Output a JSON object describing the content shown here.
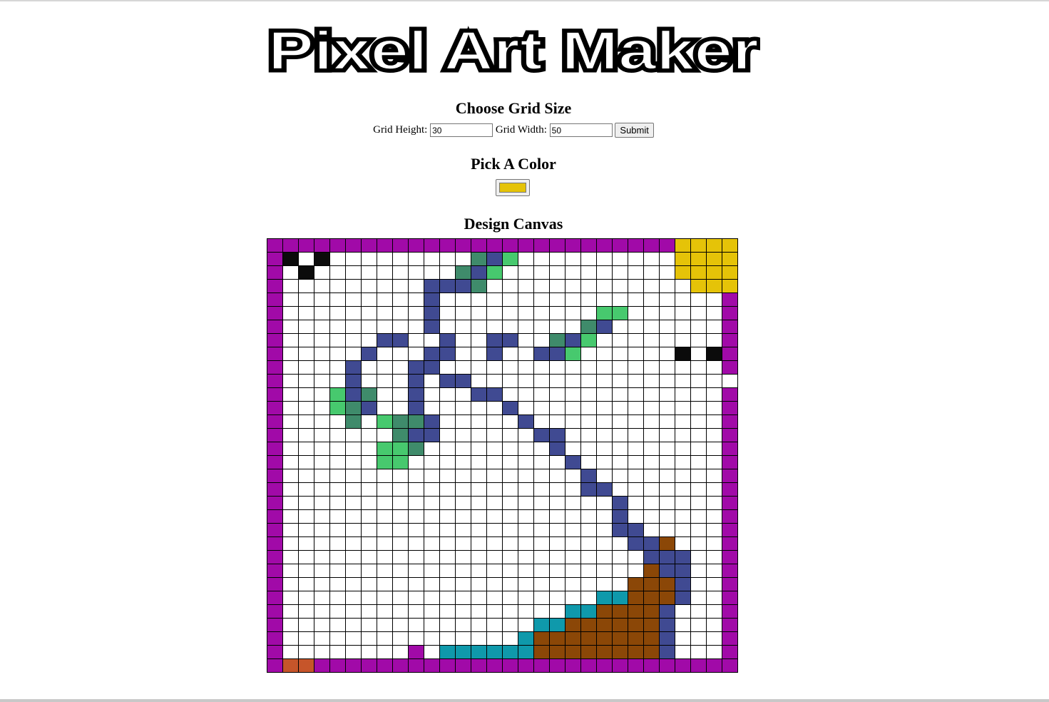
{
  "page": {
    "logo_text": "Pixel Art Maker",
    "grid_heading": "Choose Grid Size",
    "grid_height_label": "Grid Height:",
    "grid_height_value": "30",
    "grid_width_label": "Grid Width:",
    "grid_width_value": "50",
    "submit_label": "Submit",
    "color_heading": "Pick A Color",
    "selected_color": "#e5c308",
    "canvas_heading": "Design Canvas"
  },
  "canvas": {
    "visible_columns": 30,
    "visible_rows": 32,
    "palette": {
      "P": "#a10aa8",
      "Y": "#e5c308",
      "K": "#0b0b0b",
      "B": "#404a92",
      "G": "#3f8b6b",
      "L": "#47c96e",
      "T": "#0f99ab",
      "R": "#8b4707",
      "O": "#c6552a",
      ".": "#ffffff"
    },
    "rows": [
      "PPPPPPPPPPPPPPPPPPPPPPPPPPYYYY",
      "PK.K.........GBL..........YYYY",
      "P.K.........GBL...........YYYY",
      "P.........BBBG.............YYY",
      "P.........B..................P",
      "P.........B..........LL......P",
      "P.........B.........GB.......P",
      "P......BB..B..BB..GBL........P",
      "P.....B...BB..B..BBL......K.KP",
      "P....B...BB..................P",
      "P....B...B.BB..................P",
      "P...LBG..B...BB..............P",
      "P...LGB..B.....B.............P",
      "P....G.LGGB.....B............P",
      "P.......GBB......BB..........P",
      "P......LLG........B..........P",
      "P......LL..........B.........P",
      "P...................B........P",
      "P...................BB.......P",
      "P.....................B......P",
      "P.....................B......P",
      "P.....................BB.....P",
      "P......................BBR...P",
      "P.......................BBB..P",
      "P.......................RBB..P",
      "P......................RRRB..P",
      "P....................TTRRRB..P",
      "P..................TTRRRRB...P",
      "P................TTRRRRRRB...P",
      "P...............TRRRRRRRRB...P",
      "P........P.TTTTTTRRRRRRRRB...P",
      "POOPPPPPPPPPPPPPPPPPPPPPPPPPPP"
    ]
  }
}
